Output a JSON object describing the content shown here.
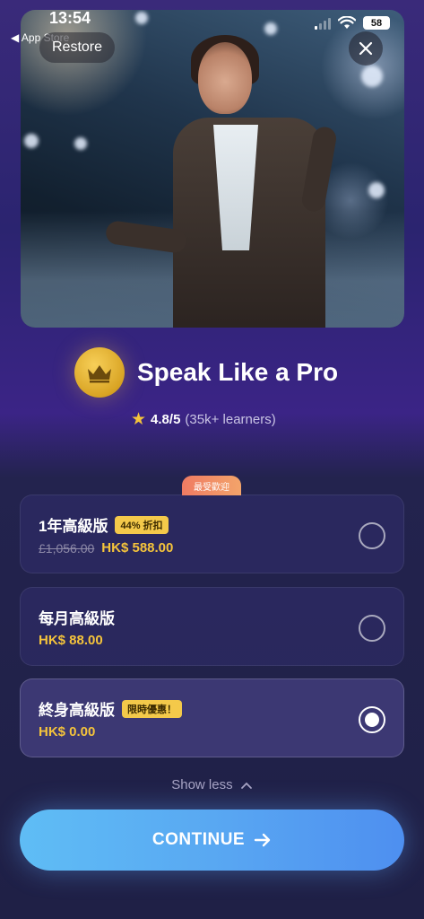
{
  "status_bar": {
    "time": "13:54",
    "back_app": "◀ App Store",
    "battery": "58"
  },
  "hero": {
    "restore_label": "Restore",
    "close_icon": "close-icon"
  },
  "header": {
    "title": "Speak Like a Pro",
    "rating_value": "4.8/5",
    "rating_sub": "(35k+ learners)"
  },
  "plans": [
    {
      "name": "1年高級版",
      "tag": "44% 折扣",
      "old_price": "£1,056.00",
      "price": "HK$ 588.00",
      "badge": "最受歡迎",
      "selected": false
    },
    {
      "name": "每月高級版",
      "tag": "",
      "old_price": "",
      "price": "HK$ 88.00",
      "selected": false
    },
    {
      "name": "終身高級版",
      "tag": "限時優惠！",
      "old_price": "",
      "price": "HK$ 0.00",
      "selected": true
    }
  ],
  "show_less_label": "Show less",
  "continue_label": "CONTINUE",
  "colors": {
    "accent_gold": "#f5c43b",
    "button_blue": "#59a8f2",
    "badge_orange": "#ef7b63"
  }
}
